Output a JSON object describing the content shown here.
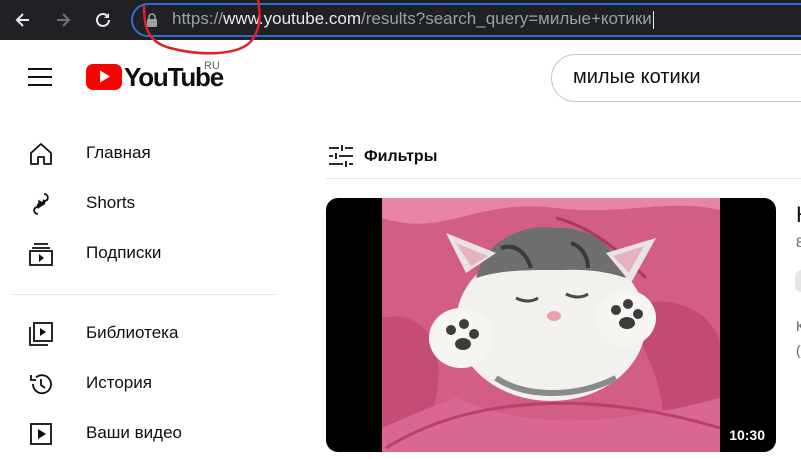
{
  "browser": {
    "url_scheme": "https://",
    "url_host": "www.youtube.com",
    "url_path": "/results?search_query=милые+котики",
    "icons": {
      "back": "arrow-left-icon",
      "forward": "arrow-right-icon",
      "reload": "reload-icon",
      "lock": "lock-icon"
    }
  },
  "header": {
    "logo_text": "YouTube",
    "region": "RU",
    "search_query": "милые котики"
  },
  "sidebar": {
    "items": [
      {
        "label": "Главная",
        "icon": "home-icon"
      },
      {
        "label": "Shorts",
        "icon": "shorts-icon"
      },
      {
        "label": "Подписки",
        "icon": "subscriptions-icon"
      },
      {
        "label": "Библиотека",
        "icon": "library-icon"
      },
      {
        "label": "История",
        "icon": "history-icon"
      },
      {
        "label": "Ваши видео",
        "icon": "your-videos-icon"
      }
    ]
  },
  "main": {
    "filters_label": "Фильтры",
    "results": [
      {
        "duration": "10:30",
        "title_partial": "К",
        "meta_partial_1": "8",
        "meta_partial_2": "К",
        "meta_partial_3": "("
      }
    ]
  },
  "colors": {
    "brand_red": "#ff0000",
    "address_focus": "#2f6fd1",
    "annotation_red": "#e0202a"
  }
}
